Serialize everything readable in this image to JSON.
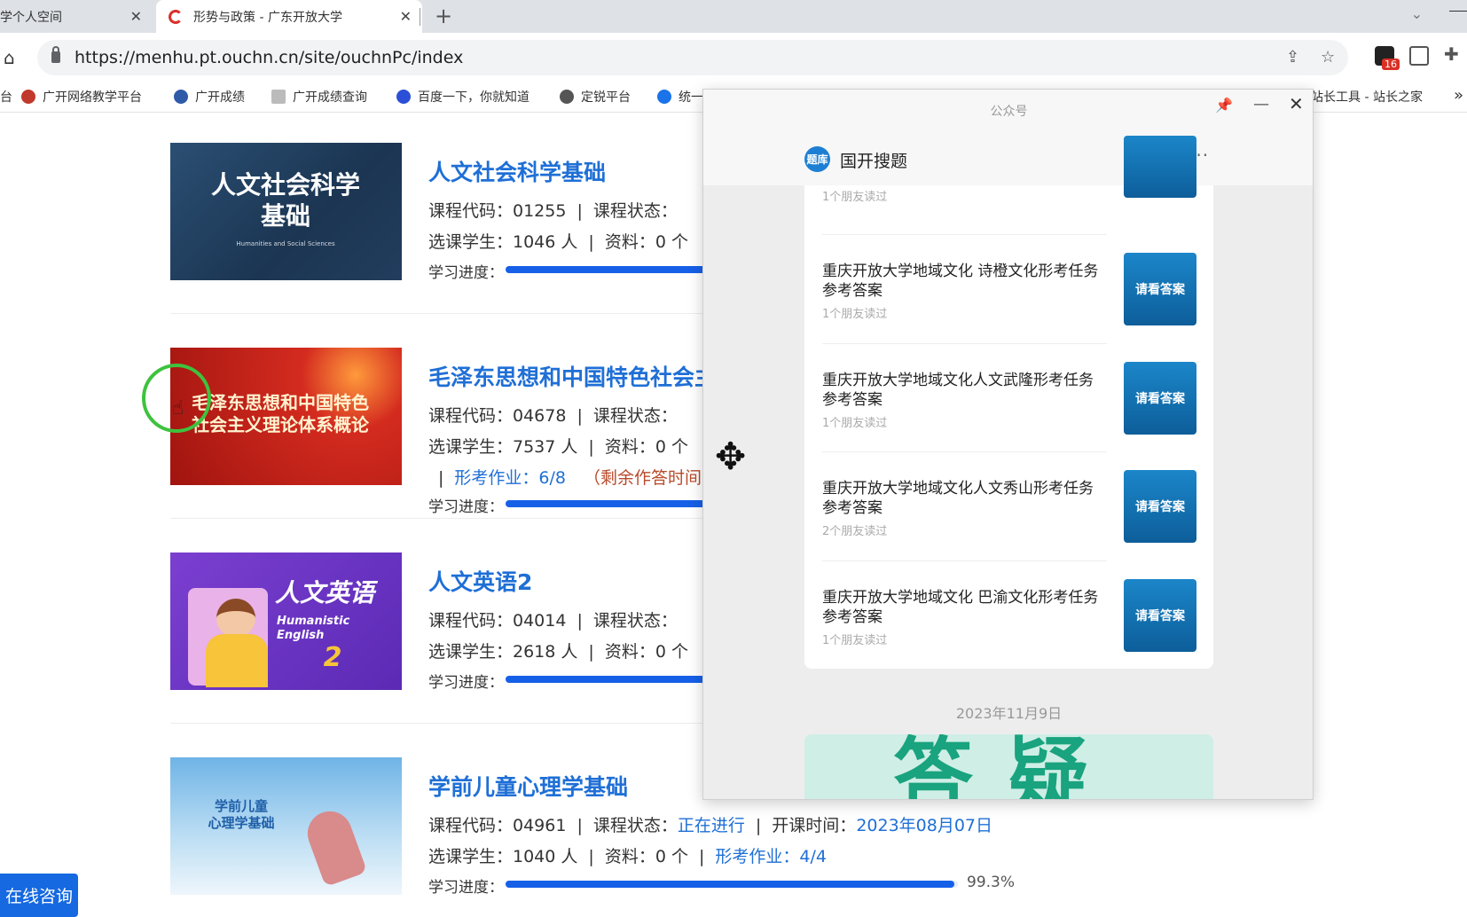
{
  "browser": {
    "tabs": [
      {
        "title": "学个人空间"
      },
      {
        "title": "形势与政策 - 广东开放大学"
      }
    ],
    "url": "https://menhu.pt.ouchn.cn/site/ouchnPc/index",
    "ext_badge": "16",
    "bookmarks": [
      {
        "label": "广开网络教学平台",
        "color": "#c0392b"
      },
      {
        "label": "广开成绩",
        "color": "#2e5aa8"
      },
      {
        "label": "广开成绩查询",
        "color": "#999999"
      },
      {
        "label": "百度一下，你就知道",
        "color": "#2b4fd6"
      },
      {
        "label": "定锐平台",
        "color": "#555555"
      },
      {
        "label": "统一",
        "color": "#1a73e8"
      },
      {
        "label": "站长工具 - 站长之家",
        "color": "#ffffff"
      }
    ]
  },
  "courses": [
    {
      "thumb_text": "人文社会科学\n基础",
      "thumb_sub": "Humanities and Social Sciences",
      "title": "人文社会科学基础",
      "line1": "课程代码：01255",
      "line1b": "课程状态：",
      "line2": "选课学生：1046 人",
      "line2b": "资料：0 个",
      "progress_label": "学习进度：",
      "progress": 0.993
    },
    {
      "thumb_text": "毛泽东思想和中国特色\n社会主义理论体系概论",
      "title": "毛泽东思想和中国特色社会主义理论体系概论",
      "line1": "课程代码：04678",
      "line1b": "课程状态：",
      "line2": "选课学生：7537 人",
      "line2b": "资料：0 个",
      "line3a": "形考作业：6/8",
      "line3b": "（剩余作答时间",
      "progress_label": "学习进度：",
      "progress": 0.993
    },
    {
      "thumb_text": "人文英语",
      "thumb_sub": "Humanistic English",
      "thumb_num": "2",
      "title": "人文英语2",
      "line1": "课程代码：04014",
      "line1b": "课程状态：",
      "line2": "选课学生：2618 人",
      "line2b": "资料：0 个",
      "progress_label": "学习进度：",
      "progress": 0.993
    },
    {
      "thumb_text": "学前儿童\n心理学基础",
      "title": "学前儿童心理学基础",
      "line1": "课程代码：04961",
      "line1b": "课程状态：",
      "status": "正在进行",
      "open_label": "开课时间：",
      "open_date": "2023年08月07日",
      "line2": "选课学生：1040 人",
      "line2b": "资料：0 个",
      "line2c": "形考作业：4/4",
      "progress_label": "学习进度：",
      "progress": 0.993,
      "progress_text": "99.3%"
    }
  ],
  "chat_button": "在线咨询",
  "popup": {
    "window_title": "公众号",
    "account_name": "国开搜题",
    "avatar_text": "题库",
    "more": "···",
    "articles": [
      {
        "title": "",
        "meta": "1个朋友读过"
      },
      {
        "title": "重庆开放大学地域文化 诗橙文化形考任务参考答案",
        "meta": "1个朋友读过",
        "thumb": "请看答案"
      },
      {
        "title": "重庆开放大学地域文化人文武隆形考任务参考答案",
        "meta": "1个朋友读过",
        "thumb": "请看答案"
      },
      {
        "title": "重庆开放大学地域文化人文秀山形考任务参考答案",
        "meta": "2个朋友读过",
        "thumb": "请看答案"
      },
      {
        "title": "重庆开放大学地域文化 巴渝文化形考任务参考答案",
        "meta": "1个朋友读过",
        "thumb": "请看答案"
      }
    ],
    "date": "2023年11月9日",
    "next_card_text": "答疑"
  }
}
